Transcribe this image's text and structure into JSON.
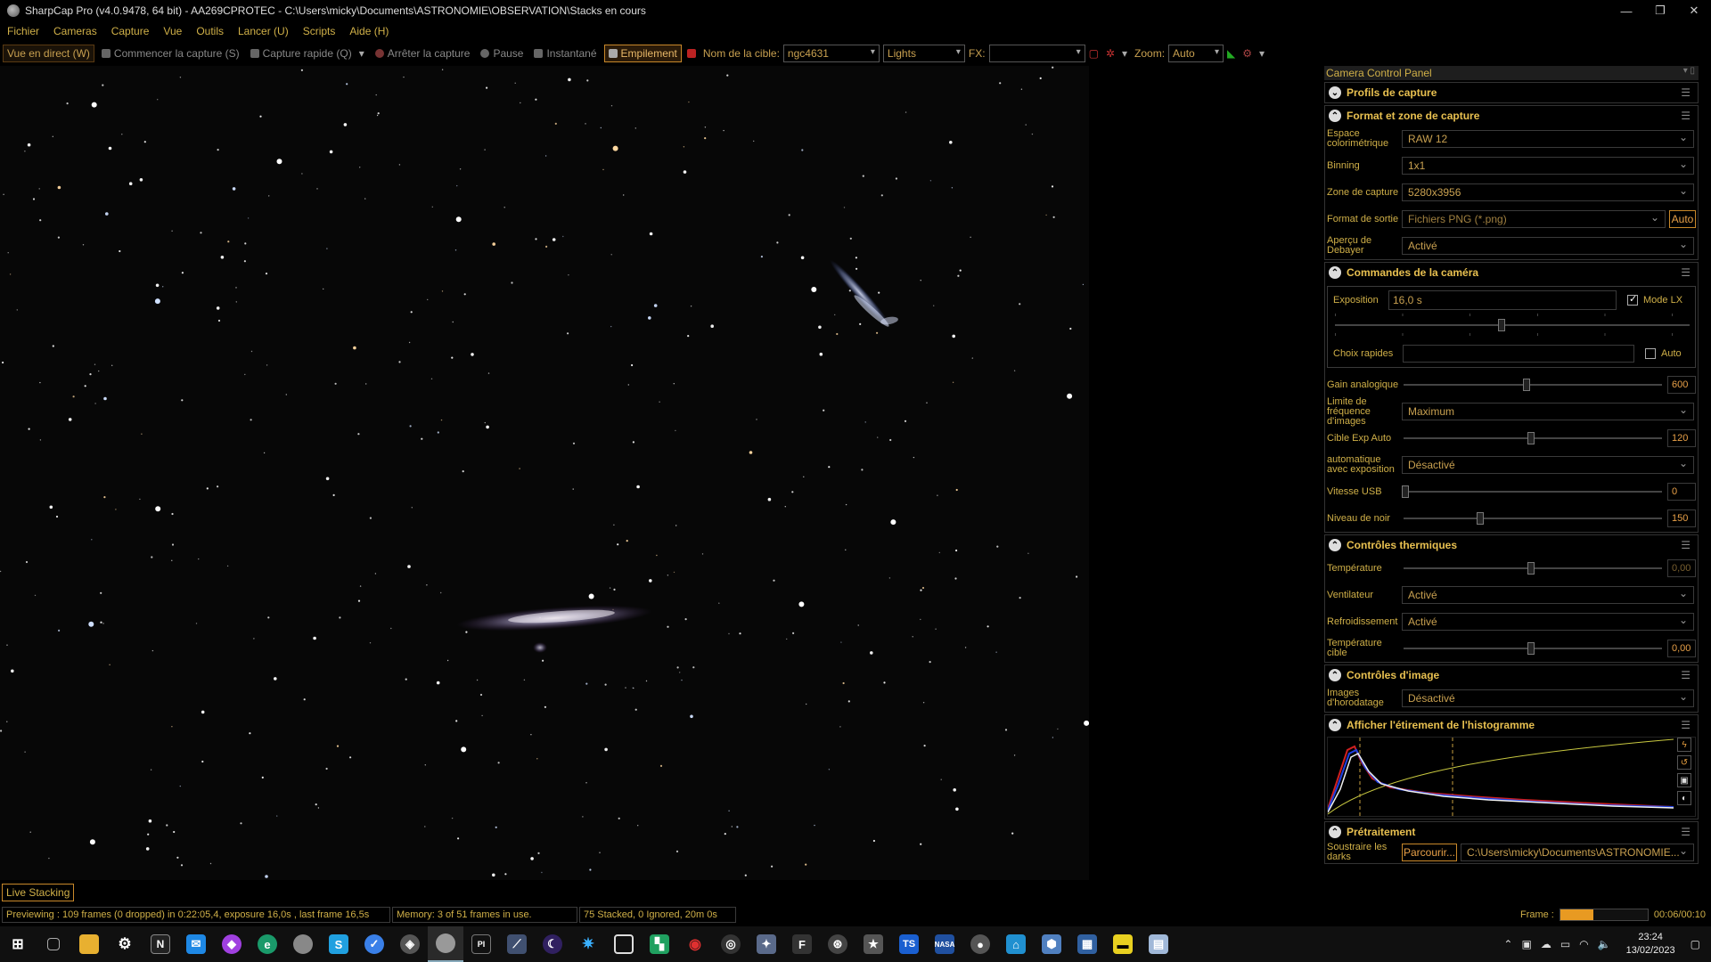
{
  "window": {
    "title": "SharpCap Pro (v4.0.9478, 64 bit) - AA269CPROTEC - C:\\Users\\micky\\Documents\\ASTRONOMIE\\OBSERVATION\\Stacks en cours",
    "minimize": "—",
    "maximize": "❐",
    "close": "✕"
  },
  "menu": [
    "Fichier",
    "Cameras",
    "Capture",
    "Vue",
    "Outils",
    "Lancer (U)",
    "Scripts",
    "Aide (H)"
  ],
  "toolbar": {
    "live_view": "Vue en direct (W)",
    "start_capture": "Commencer la capture (S)",
    "quick_capture": "Capture rapide (Q)",
    "stop_capture": "Arrêter la capture",
    "pause": "Pause",
    "snapshot": "Instantané",
    "stacking": "Empilement",
    "target_label": "Nom de la cible:",
    "target_value": "ngc4631",
    "frame_type": "Lights",
    "fx_label": "FX:",
    "fx_value": "",
    "zoom_label": "Zoom:",
    "zoom_value": "Auto"
  },
  "panel": {
    "title": "Camera Control Panel",
    "sections": {
      "profiles": {
        "title": "Profils de capture"
      },
      "format": {
        "title": "Format et zone de capture",
        "color_space_label": "Espace colorimétrique",
        "color_space_value": "RAW 12",
        "binning_label": "Binning",
        "binning_value": "1x1",
        "zone_label": "Zone de capture",
        "zone_value": "5280x3956",
        "output_label": "Format de sortie",
        "output_value": "Fichiers PNG (*.png)",
        "output_auto": "Auto",
        "debayer_label": "Aperçu de Debayer",
        "debayer_value": "Activé"
      },
      "camera": {
        "title": "Commandes de la caméra",
        "exposure_label": "Exposition",
        "exposure_value": "16,0 s",
        "lx_mode_label": "Mode LX",
        "lx_mode_checked": true,
        "quick_choice_label": "Choix rapides",
        "quick_choice_value": "",
        "quick_auto_label": "Auto",
        "gain_label": "Gain analogique",
        "gain_value": "600",
        "fps_limit_label": "Limite de fréquence d'images",
        "fps_limit_value": "Maximum",
        "auto_exp_target_label": "Cible Exp Auto",
        "auto_exp_target_value": "120",
        "auto_exposure_label": "automatique avec exposition",
        "auto_exposure_value": "Désactivé",
        "usb_speed_label": "Vitesse USB",
        "usb_speed_value": "0",
        "black_level_label": "Niveau de noir",
        "black_level_value": "150"
      },
      "thermal": {
        "title": "Contrôles thermiques",
        "temperature_label": "Température",
        "temperature_value": "0,00",
        "fan_label": "Ventilateur",
        "fan_value": "Activé",
        "cooling_label": "Refroidissement",
        "cooling_value": "Activé",
        "target_temp_label": "Température cible",
        "target_temp_value": "0,00"
      },
      "image": {
        "title": "Contrôles d'image",
        "timestamp_label": "Images d'horodatage",
        "timestamp_value": "Désactivé"
      },
      "histogram": {
        "title": "Afficher l'étirement de l'histogramme"
      },
      "preprocessing": {
        "title": "Prétraitement",
        "darks_label": "Soustraire les darks",
        "browse_label": "Parcourir...",
        "darks_path": "C:\\Users\\micky\\Documents\\ASTRONOMIE..."
      }
    }
  },
  "live_stacking_tab": "Live Stacking",
  "status": {
    "preview": "Previewing : 109 frames (0 dropped) in 0:22:05,4, exposure 16,0s , last frame 16,5s",
    "memory": "Memory: 3 of 51 frames in use.",
    "stacked": "75 Stacked, 0 Ignored, 20m 0s",
    "frame_label": "Frame :",
    "frame_progress": 0.375,
    "frame_time": "00:06/00:10"
  },
  "taskbar": {
    "icons": [
      "windows-start",
      "task-view",
      "file-explorer",
      "settings",
      "notion",
      "mail",
      "messenger",
      "edge",
      "sharpcap-alt",
      "skype",
      "viber",
      "nina",
      "sharpcap",
      "pixinsight",
      "siril",
      "stellarium",
      "astap",
      "photoshop",
      "dss",
      "ascom",
      "sequence",
      "phd2",
      "astro-tool",
      "filezilla",
      "guiding",
      "favorites",
      "ts-tool",
      "nasa",
      "obs",
      "device-hub",
      "network",
      "calc",
      "sticky-notes",
      "explorer-2"
    ],
    "clock_time": "23:24",
    "clock_date": "13/02/2023"
  },
  "colors": {
    "accent_orange": "#c8882a",
    "label_gold": "#d0b048",
    "background": "#000000"
  }
}
